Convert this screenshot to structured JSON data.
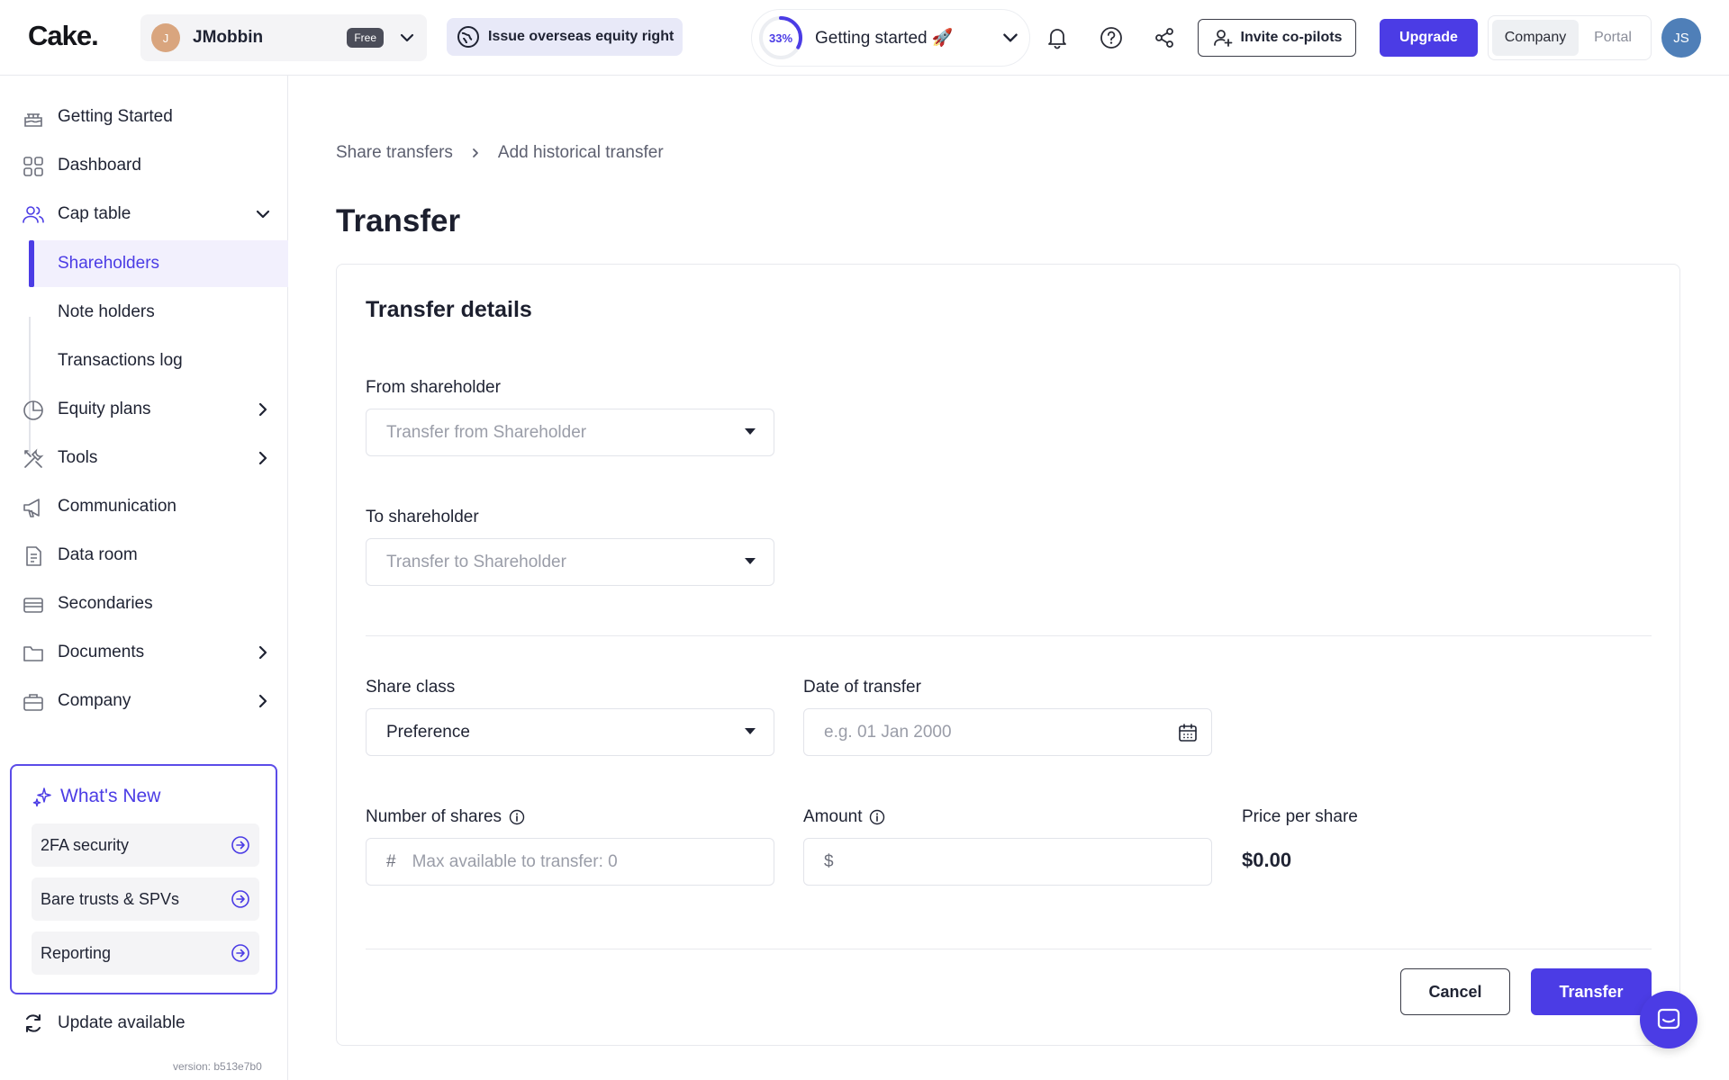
{
  "topbar": {
    "logo": "Cake.",
    "account": {
      "initial": "J",
      "name": "JMobbin",
      "plan_badge": "Free"
    },
    "promo": "Issue overseas equity right",
    "getting_started": {
      "percent": "33%",
      "label": "Getting started 🚀",
      "progress": 0.33
    },
    "invite_label": "Invite co-pilots",
    "upgrade_label": "Upgrade",
    "view_toggle": {
      "company": "Company",
      "portal": "Portal",
      "selected": "Company"
    },
    "user_initials": "JS"
  },
  "sidebar": {
    "items": [
      {
        "label": "Getting Started",
        "icon": "cake-icon"
      },
      {
        "label": "Dashboard",
        "icon": "grid-icon"
      },
      {
        "label": "Cap table",
        "icon": "users-icon",
        "expanded": true
      },
      {
        "label": "Equity plans",
        "icon": "pie-icon"
      },
      {
        "label": "Tools",
        "icon": "tools-icon"
      },
      {
        "label": "Communication",
        "icon": "megaphone-icon"
      },
      {
        "label": "Data room",
        "icon": "document-icon"
      },
      {
        "label": "Secondaries",
        "icon": "card-icon"
      },
      {
        "label": "Documents",
        "icon": "folder-icon"
      },
      {
        "label": "Company",
        "icon": "briefcase-icon"
      }
    ],
    "cap_table_sub": [
      {
        "label": "Shareholders",
        "active": true
      },
      {
        "label": "Note holders"
      },
      {
        "label": "Transactions log"
      }
    ],
    "whats_new": {
      "title": "What's New",
      "items": [
        "2FA security",
        "Bare trusts & SPVs",
        "Reporting"
      ]
    },
    "update_label": "Update available",
    "version": "version: b513e7b0"
  },
  "breadcrumb": {
    "parent": "Share transfers",
    "current": "Add historical transfer"
  },
  "page_title": "Transfer",
  "form": {
    "section_title": "Transfer details",
    "from_label": "From shareholder",
    "from_placeholder": "Transfer from Shareholder",
    "to_label": "To shareholder",
    "to_placeholder": "Transfer to Shareholder",
    "share_class_label": "Share class",
    "share_class_value": "Preference",
    "date_label": "Date of transfer",
    "date_placeholder": "e.g. 01 Jan 2000",
    "shares_label": "Number of shares",
    "shares_prefix": "#",
    "shares_placeholder": "Max available to transfer: 0",
    "amount_label": "Amount",
    "amount_prefix": "$",
    "amount_value": "",
    "price_label": "Price per share",
    "price_value": "$0.00",
    "cancel_label": "Cancel",
    "submit_label": "Transfer"
  },
  "colors": {
    "accent": "#4b3ce5",
    "border": "#e8e9ee",
    "text": "#1f2333"
  }
}
